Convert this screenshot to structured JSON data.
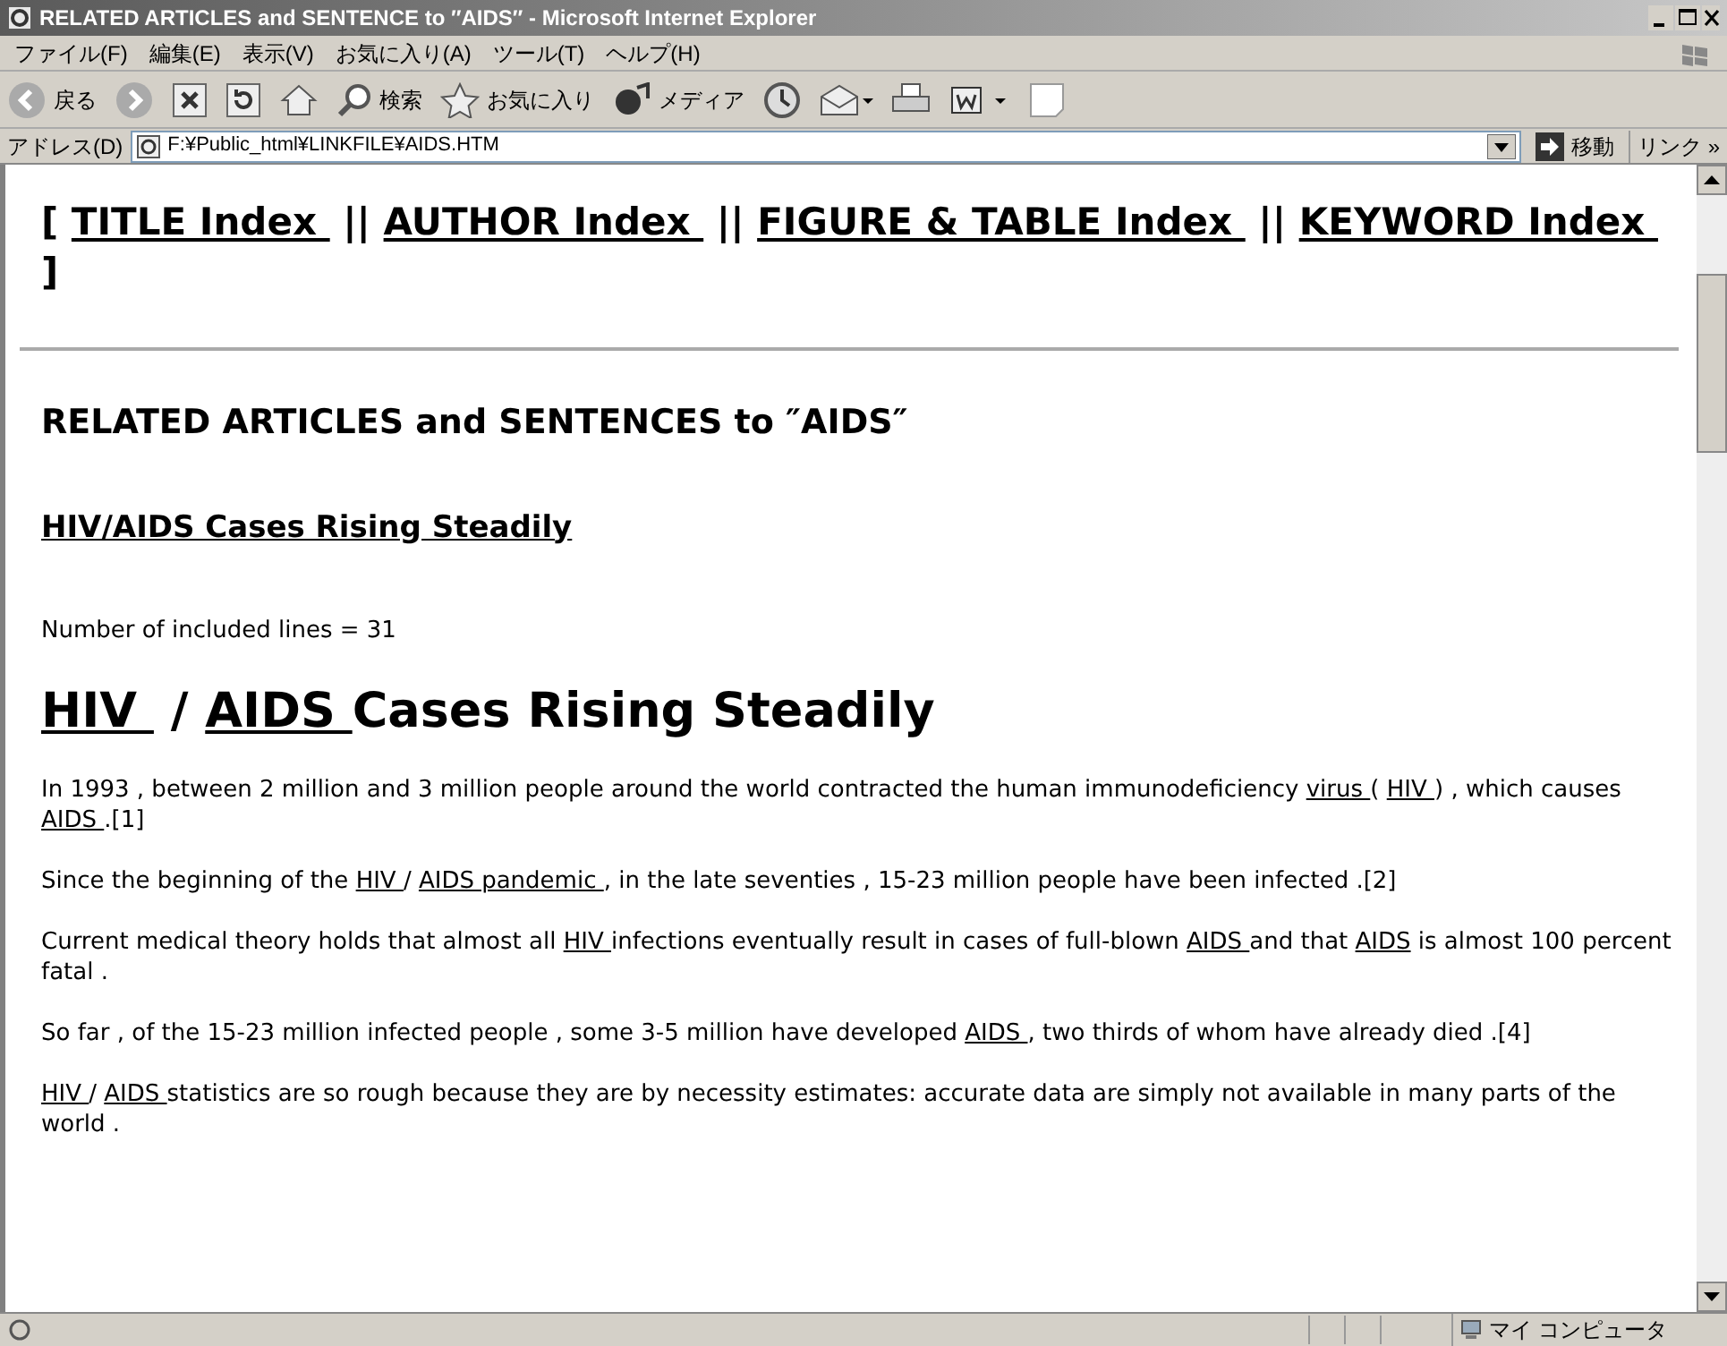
{
  "window": {
    "title": "RELATED ARTICLES and SENTENCE to ″AIDS″ - Microsoft Internet Explorer"
  },
  "menu": [
    "ファイル(F)",
    "編集(E)",
    "表示(V)",
    "お気に入り(A)",
    "ツール(T)",
    "ヘルプ(H)"
  ],
  "toolbar": [
    {
      "kind": "back",
      "label": "戻る"
    },
    {
      "kind": "forward"
    },
    {
      "kind": "stop"
    },
    {
      "kind": "refresh"
    },
    {
      "kind": "home"
    },
    {
      "kind": "search",
      "label": "検索"
    },
    {
      "kind": "favorites",
      "label": "お気に入り"
    },
    {
      "kind": "media",
      "label": "メディア"
    },
    {
      "kind": "history"
    },
    {
      "kind": "mail"
    },
    {
      "kind": "print"
    },
    {
      "kind": "word"
    },
    {
      "kind": "blank"
    }
  ],
  "address": {
    "label": "アドレス(D)",
    "value": "F:¥Public_html¥LINKFILE¥AIDS.HTM",
    "go": "移動",
    "links": "リンク »"
  },
  "content": [
    {
      "kind": "nav",
      "segments": [
        {
          "text": "[ "
        },
        {
          "text": "TITLE Index ",
          "link": true
        },
        {
          "text": " || "
        },
        {
          "text": "AUTHOR Index ",
          "link": true
        },
        {
          "text": " || "
        },
        {
          "text": "FIGURE & TABLE Index ",
          "link": true
        },
        {
          "text": " || "
        },
        {
          "text": "KEYWORD Index ",
          "link": true
        },
        {
          "text": " ]"
        }
      ]
    },
    {
      "kind": "rule"
    },
    {
      "kind": "h2",
      "segments": [
        {
          "text": "RELATED ARTICLES and SENTENCES to ″AIDS″"
        }
      ]
    },
    {
      "kind": "h3",
      "segments": [
        {
          "text": "HIV/AIDS Cases Rising Steadily",
          "link": true
        }
      ]
    },
    {
      "kind": "p",
      "segments": [
        {
          "text": "Number of included lines = 31"
        }
      ]
    },
    {
      "kind": "h1",
      "segments": [
        {
          "text": "HIV ",
          "link": true
        },
        {
          "text": " / "
        },
        {
          "text": "AIDS ",
          "link": true
        },
        {
          "text": "Cases Rising Steadily"
        }
      ]
    },
    {
      "kind": "p",
      "segments": [
        {
          "text": "In 1993 , between 2 million and 3 million people around the world contracted the human immunodeficiency "
        },
        {
          "text": "virus ",
          "link": true
        },
        {
          "text": "( "
        },
        {
          "text": "HIV ",
          "link": true
        },
        {
          "text": ") , which causes "
        },
        {
          "text": "AIDS ",
          "link": true
        },
        {
          "text": ".[1]"
        }
      ]
    },
    {
      "kind": "p",
      "segments": [
        {
          "text": "Since the beginning of the "
        },
        {
          "text": "HIV ",
          "link": true
        },
        {
          "text": "/ "
        },
        {
          "text": "AIDS pandemic ",
          "link": true
        },
        {
          "text": ", in the late seventies , 15-23 million people have been infected .[2]"
        }
      ]
    },
    {
      "kind": "p",
      "segments": [
        {
          "text": "Current medical theory holds that almost all "
        },
        {
          "text": "HIV ",
          "link": true
        },
        {
          "text": "infections eventually result in cases of full-blown "
        },
        {
          "text": "AIDS ",
          "link": true
        },
        {
          "text": "and that "
        },
        {
          "text": "AIDS",
          "link": true
        },
        {
          "text": " is almost 100 percent fatal ."
        }
      ]
    },
    {
      "kind": "p",
      "segments": [
        {
          "text": "So far , of the 15-23 million infected people , some 3-5 million have developed "
        },
        {
          "text": "AIDS ",
          "link": true
        },
        {
          "text": ", two thirds of whom have already died .[4]"
        }
      ]
    },
    {
      "kind": "p",
      "segments": [
        {
          "text": "HIV ",
          "link": true
        },
        {
          "text": "/ "
        },
        {
          "text": "AIDS ",
          "link": true
        },
        {
          "text": "statistics are so rough because they are by necessity estimates: accurate data are simply not available in many parts of the world ."
        }
      ]
    }
  ],
  "status_bar": {
    "zone": "マイ コンピュータ"
  }
}
